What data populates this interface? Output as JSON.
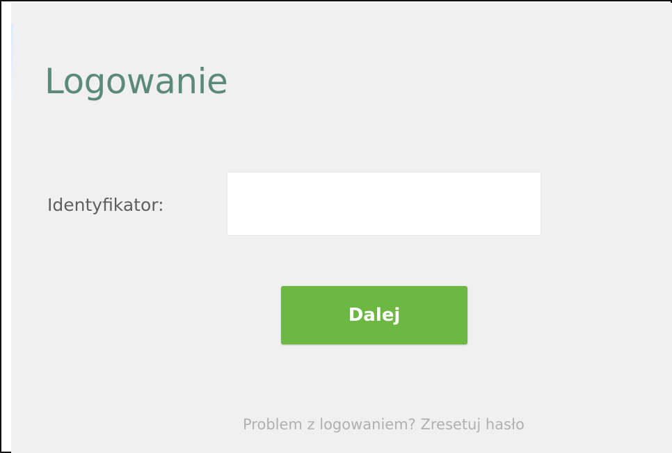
{
  "login": {
    "title": "Logowanie",
    "identifier_label": "Identyfikator:",
    "identifier_value": "",
    "identifier_placeholder": "",
    "next_button_label": "Dalej",
    "reset_link_text": "Problem z logowaniem? Zresetuj hasło"
  },
  "colors": {
    "title": "#5b8a7a",
    "button_background": "#6cb843",
    "panel_background": "#f0f0f0",
    "link_text": "#b0b0b0"
  }
}
